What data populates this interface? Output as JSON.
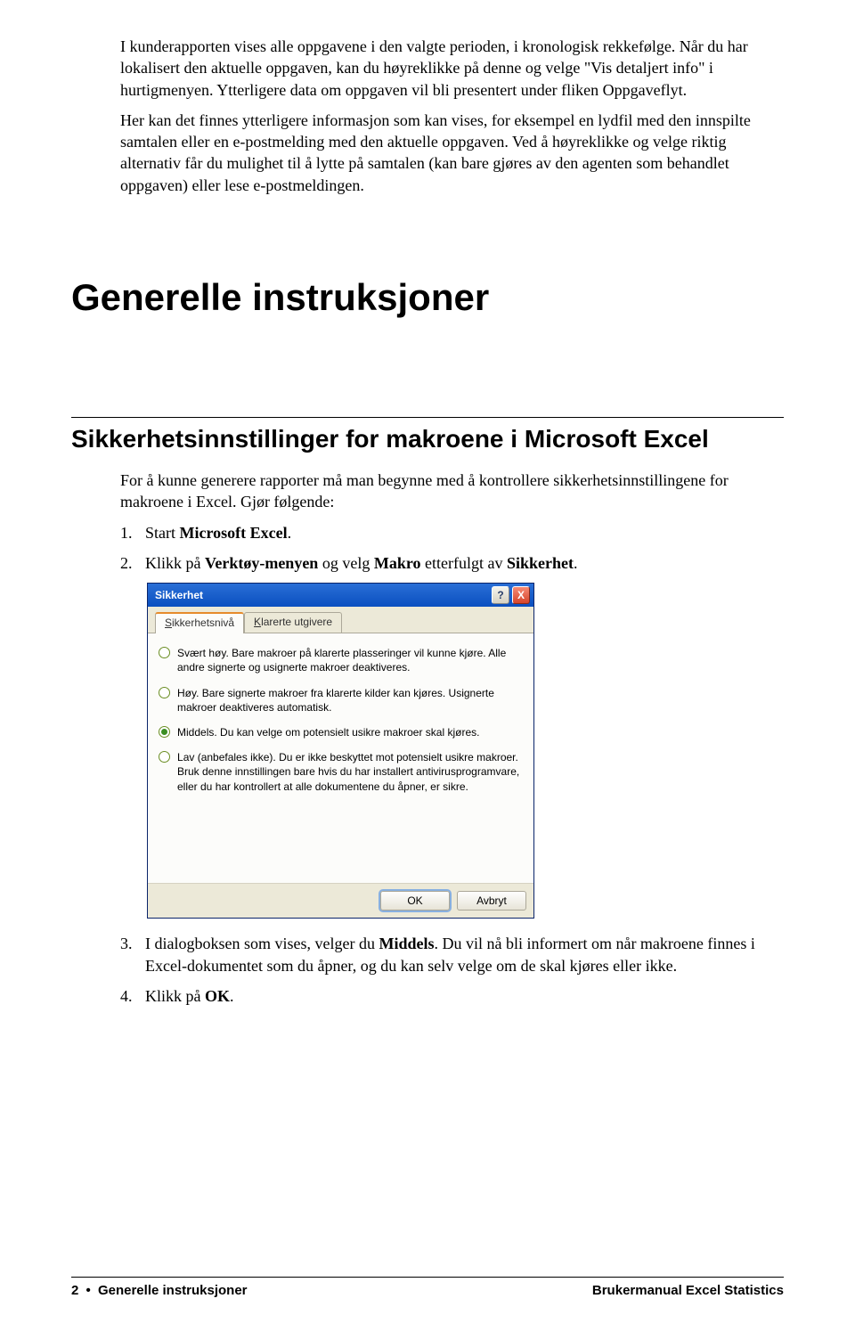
{
  "intro": {
    "p1": "I kunderapporten vises alle oppgavene i den valgte perioden, i kronologisk rekkefølge. Når du har lokalisert den aktuelle oppgaven, kan du høyreklikke på denne og velge \"Vis detaljert info\" i hurtigmenyen. Ytterligere data om oppgaven vil bli presentert under fliken Oppgaveflyt.",
    "p2": "Her kan det finnes ytterligere informasjon som kan vises, for eksempel en lydfil med den innspilte samtalen eller en e-postmelding med den aktuelle oppgaven. Ved å høyreklikke og velge riktig alternativ får du mulighet til å lytte på samtalen (kan bare gjøres av den agenten som behandlet oppgaven) eller lese e-postmeldingen."
  },
  "heading_main": "Generelle instruksjoner",
  "heading_sub": "Sikkerhetsinnstillinger for makroene i Microsoft Excel",
  "sub_intro": "For å kunne generere rapporter må man begynne med å kontrollere sikkerhetsinnstillingene for makroene i Excel. Gjør følgende:",
  "steps": {
    "s1_num": "1.",
    "s1_a": "Start ",
    "s1_b": "Microsoft Excel",
    "s1_c": ".",
    "s2_num": "2.",
    "s2_a": "Klikk på ",
    "s2_b": "Verktøy-menyen",
    "s2_c": " og velg ",
    "s2_d": "Makro",
    "s2_e": " etterfulgt av ",
    "s2_f": "Sikkerhet",
    "s2_g": ".",
    "s3_num": "3.",
    "s3_a": "I dialogboksen som vises, velger du ",
    "s3_b": "Middels",
    "s3_c": ". Du vil nå bli informert om når makroene finnes i Excel-dokumentet som du åpner, og du kan selv velge om de skal kjøres eller ikke.",
    "s4_num": "4.",
    "s4_a": "Klikk på ",
    "s4_b": "OK",
    "s4_c": "."
  },
  "dialog": {
    "title": "Sikkerhet",
    "help_glyph": "?",
    "close_glyph": "X",
    "tab1_u": "S",
    "tab1_rest": "ikkerhetsnivå",
    "tab2_u": "K",
    "tab2_rest": "larerte utgivere",
    "opt1_u": "S",
    "opt1_rest": "vært høy. Bare makroer på klarerte plasseringer vil kunne kjøre. Alle andre signerte og usignerte makroer deaktiveres.",
    "opt2_u": "H",
    "opt2_rest": "øy. Bare signerte makroer fra klarerte kilder kan kjøres. Usignerte makroer deaktiveres automatisk.",
    "opt3_u": "M",
    "opt3_rest": "iddels. Du kan velge om potensielt usikre makroer skal kjøres.",
    "opt4_u": "L",
    "opt4_rest": "av (anbefales ikke). Du er ikke beskyttet mot potensielt usikre makroer. Bruk denne innstillingen bare hvis du har installert antivirusprogramvare, eller du har kontrollert at alle dokumentene du åpner, er sikre.",
    "ok": "OK",
    "cancel": "Avbryt"
  },
  "footer": {
    "page": "2",
    "bullet": "•",
    "section": "Generelle instruksjoner",
    "manual": "Brukermanual Excel Statistics"
  }
}
